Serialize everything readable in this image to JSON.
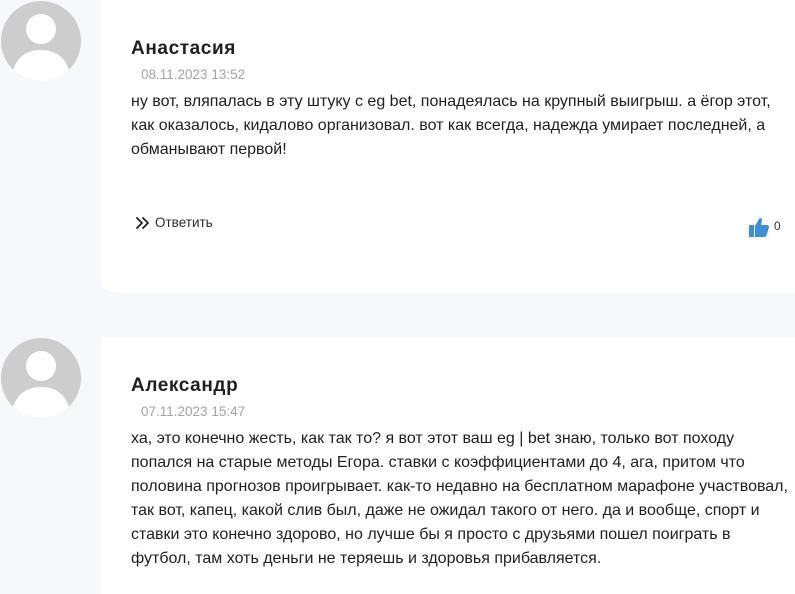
{
  "comments": [
    {
      "author": "Анастасия",
      "date": "08.11.2023 13:52",
      "text": "ну вот, вляпалась в эту штуку с eg bet, понадеялась на крупный выигрыш. а ёгор этот, как оказалось, кидалово организовал. вот как всегда, надежда умирает последней, а обманывают первой!",
      "reply_label": "Ответить",
      "likes": "0"
    },
    {
      "author": "Александр",
      "date": "07.11.2023 15:47",
      "text": "ха, это конечно жесть, как так то? я вот этот ваш eg | bet знаю, только вот походу попался на старые методы Егора. ставки с коэффициентами до 4, ага, притом что половина прогнозов проигрывает. как-то недавно на бесплатном марафоне участвовал, так вот, капец, какой слив был, даже не ожидал такого от него. да и вообще, спорт и ставки это конечно здорово, но лучше бы я просто с друзьями пошел поиграть в футбол, там хоть деньги не теряешь и здоровья прибавляется."
    }
  ],
  "icons": {
    "avatar": "default-user-avatar",
    "reply": "double-chevron-right-icon",
    "like": "thumbs-up-icon"
  },
  "colors": {
    "page_bg": "#f7f8fc",
    "card_bg": "#ffffff",
    "avatar_bg": "#cdcdcd",
    "date": "#a3a3a3",
    "like": "#3a8fd6"
  }
}
